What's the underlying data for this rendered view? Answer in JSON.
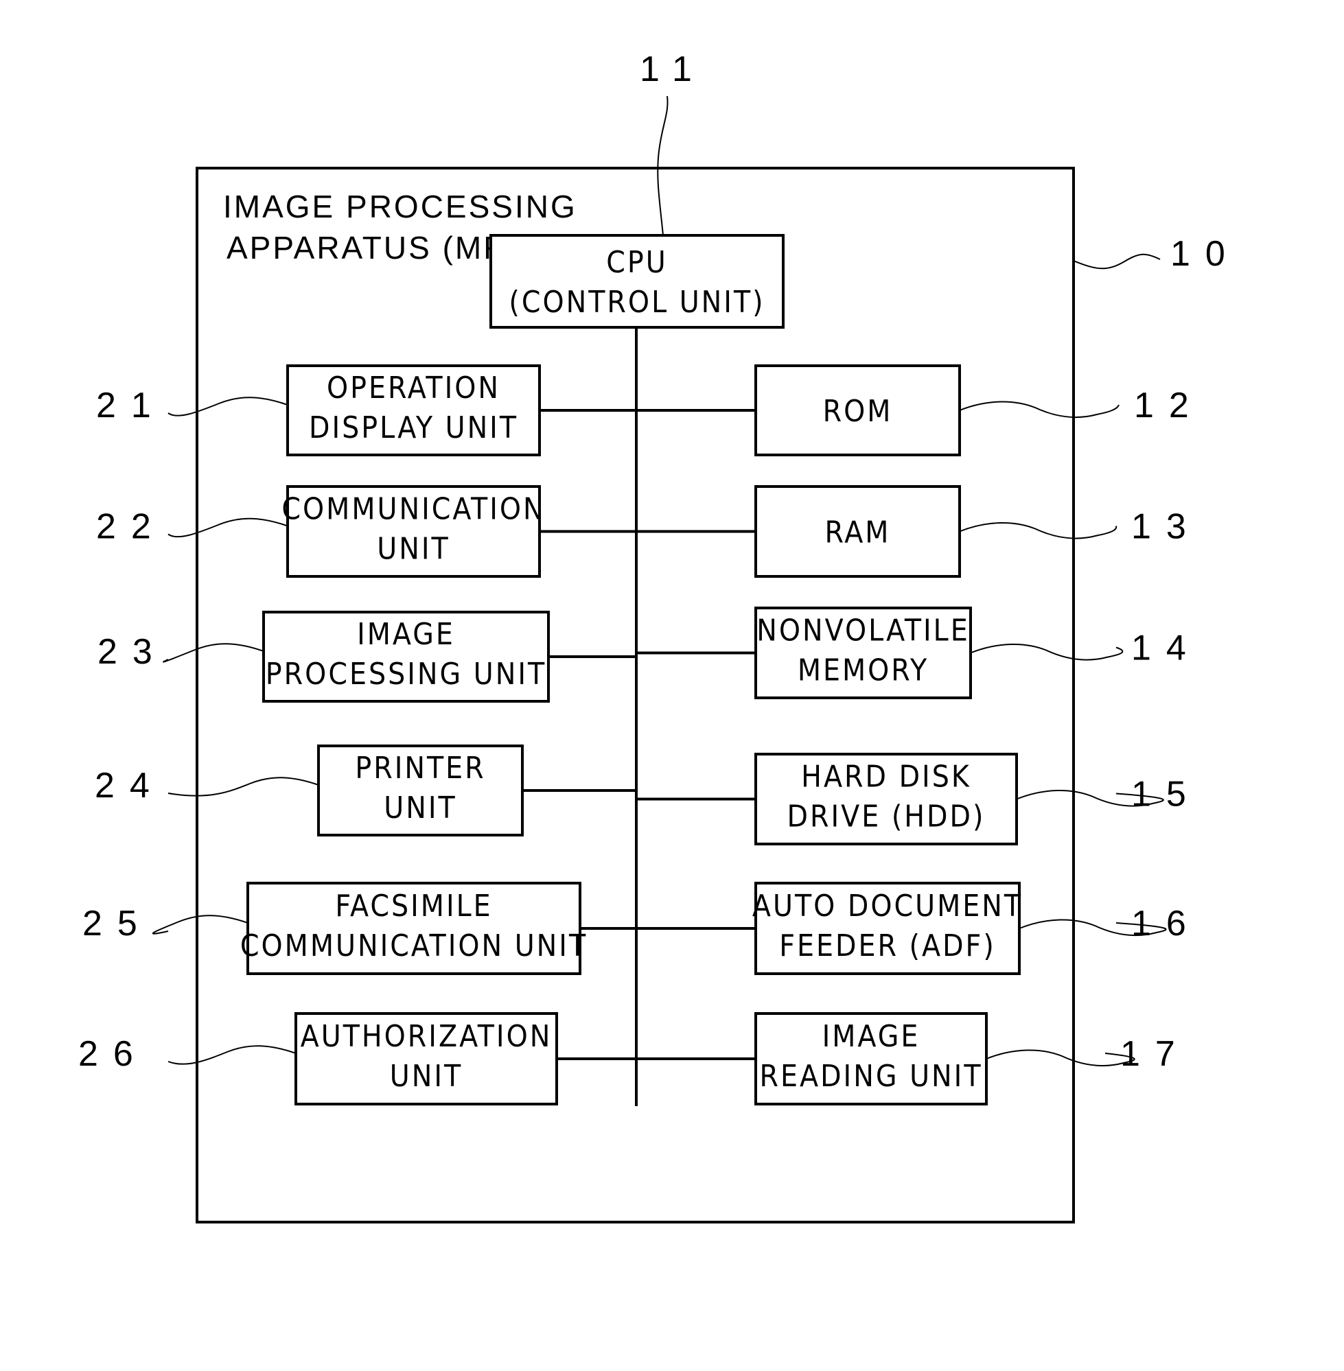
{
  "diagram": {
    "title_lines": [
      "IMAGE PROCESSING",
      "APPARATUS (MFP)"
    ],
    "apparatus_ref": "10",
    "cpu": {
      "lines": [
        "CPU",
        "(CONTROL UNIT)"
      ],
      "ref": "11"
    },
    "left_units": [
      {
        "id": "operation-display-unit",
        "lines": [
          "OPERATION",
          "DISPLAY UNIT"
        ],
        "ref": "21"
      },
      {
        "id": "communication-unit",
        "lines": [
          "COMMUNICATION",
          "UNIT"
        ],
        "ref": "22"
      },
      {
        "id": "image-processing-unit",
        "lines": [
          "IMAGE",
          "PROCESSING UNIT"
        ],
        "ref": "23"
      },
      {
        "id": "printer-unit",
        "lines": [
          "PRINTER",
          "UNIT"
        ],
        "ref": "24"
      },
      {
        "id": "facsimile-communication-unit",
        "lines": [
          "FACSIMILE",
          "COMMUNICATION UNIT"
        ],
        "ref": "25"
      },
      {
        "id": "authorization-unit",
        "lines": [
          "AUTHORIZATION",
          "UNIT"
        ],
        "ref": "26"
      }
    ],
    "right_units": [
      {
        "id": "rom",
        "lines": [
          "ROM"
        ],
        "ref": "12"
      },
      {
        "id": "ram",
        "lines": [
          "RAM"
        ],
        "ref": "13"
      },
      {
        "id": "nonvolatile-memory",
        "lines": [
          "NONVOLATILE",
          "MEMORY"
        ],
        "ref": "14"
      },
      {
        "id": "hard-disk-drive",
        "lines": [
          "HARD DISK",
          "DRIVE (HDD)"
        ],
        "ref": "15"
      },
      {
        "id": "auto-document-feeder",
        "lines": [
          "AUTO DOCUMENT",
          "FEEDER (ADF)"
        ],
        "ref": "16"
      },
      {
        "id": "image-reading-unit",
        "lines": [
          "IMAGE",
          "READING UNIT"
        ],
        "ref": "17"
      }
    ]
  }
}
